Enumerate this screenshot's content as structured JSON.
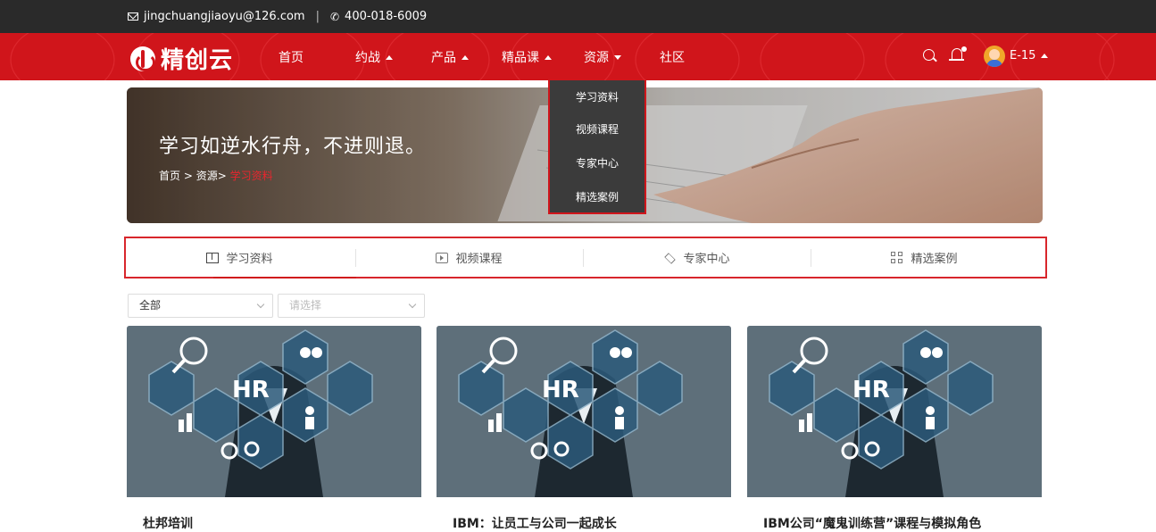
{
  "topbar": {
    "email": "jingchuangjiaoyu@126.com",
    "separator": "|",
    "phone": "400-018-6009"
  },
  "brand": {
    "name": "精创云"
  },
  "nav": {
    "items": [
      {
        "label": "首页"
      },
      {
        "label": "约战"
      },
      {
        "label": "产品"
      },
      {
        "label": "精品课"
      },
      {
        "label": "资源"
      },
      {
        "label": "社区"
      }
    ],
    "user": "E-15"
  },
  "dropdown": {
    "items": [
      "学习资料",
      "视频课程",
      "专家中心",
      "精选案例"
    ]
  },
  "banner": {
    "title": "学习如逆水行舟，不进则退。",
    "crumbs": {
      "home": "首页",
      "sep1": " > ",
      "section": "资源",
      "sep2": "> ",
      "current": "学习资料"
    }
  },
  "tabs": [
    {
      "label": "学习资料",
      "icon": "book-icon",
      "active": true
    },
    {
      "label": "视频课程",
      "icon": "video-icon",
      "active": false
    },
    {
      "label": "专家中心",
      "icon": "graduation-cap-icon",
      "active": false
    },
    {
      "label": "精选案例",
      "icon": "grid-icon",
      "active": false
    }
  ],
  "filters": {
    "category_value": "全部",
    "subcategory_placeholder": "请选择"
  },
  "cards": [
    {
      "title": "杜邦培训",
      "image_text": "HR"
    },
    {
      "title": "IBM：让员工与公司一起成长",
      "image_text": "HR"
    },
    {
      "title": "IBM公司“魔鬼训练营”课程与模拟角色",
      "image_text": "HR"
    }
  ],
  "colors": {
    "brand_red": "#d0151b",
    "topbar_bg": "#2a2a2a",
    "dropdown_bg": "#3b3b3b"
  }
}
